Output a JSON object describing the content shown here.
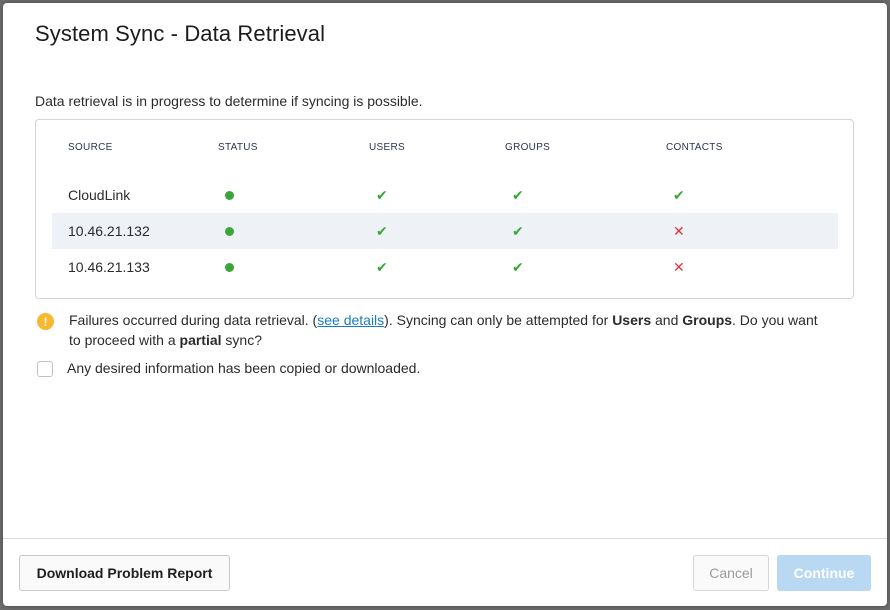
{
  "dialog": {
    "title": "System Sync - Data Retrieval",
    "intro": "Data retrieval is in progress to determine if syncing is possible."
  },
  "table": {
    "columns": [
      "SOURCE",
      "STATUS",
      "USERS",
      "GROUPS",
      "CONTACTS"
    ],
    "rows": [
      {
        "source": "CloudLink",
        "status": "ok",
        "users": "ok",
        "groups": "ok",
        "contacts": "ok"
      },
      {
        "source": "10.46.21.132",
        "status": "ok",
        "users": "ok",
        "groups": "ok",
        "contacts": "fail"
      },
      {
        "source": "10.46.21.133",
        "status": "ok",
        "users": "ok",
        "groups": "ok",
        "contacts": "fail"
      }
    ]
  },
  "warning": {
    "icon": "exclamation-icon",
    "text_before_link": "Failures occurred during data retrieval. (",
    "link_text": "see details",
    "text_after_link": "). Syncing can only be attempted for ",
    "users_word": "Users",
    "and_word": " and ",
    "groups_word": "Groups",
    "text_before_partial": ". Do you want to proceed with a ",
    "partial_word": "partial",
    "text_end": " sync?"
  },
  "confirm": {
    "label": "Any desired information has been copied or downloaded.",
    "checked": false
  },
  "buttons": {
    "report": "Download Problem Report",
    "cancel": "Cancel",
    "continue": "Continue"
  },
  "colors": {
    "status_ok": "#3aa63a",
    "check_ok": "#3aa63a",
    "cross_fail": "#e0353b",
    "warning": "#f5b82e",
    "link": "#1a7fb8",
    "continue_bg": "#b9d9f2",
    "row_alt": "#eef2f6"
  }
}
